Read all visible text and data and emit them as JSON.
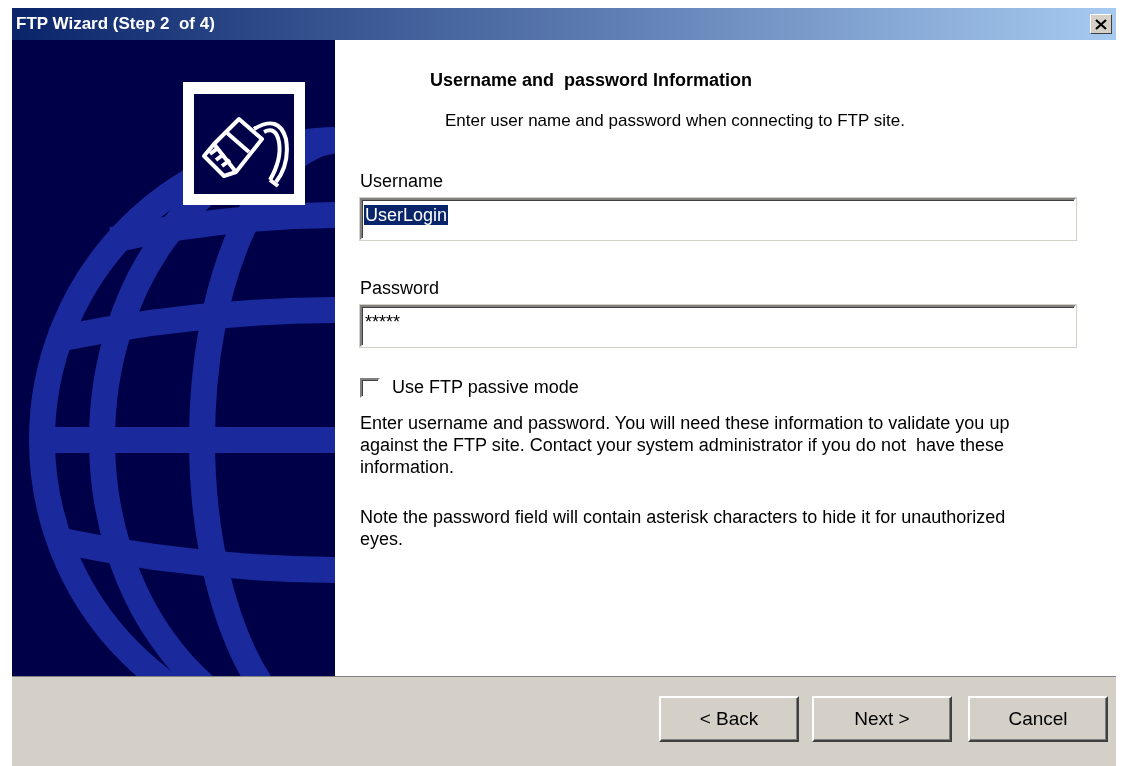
{
  "window": {
    "title": "FTP Wizard (Step 2  of 4)"
  },
  "heading": "Username and  password Information",
  "subheading": "Enter user name and password when connecting to FTP site.",
  "fields": [
    {
      "label": "Username",
      "value": "UserLogin",
      "text_selected": true
    },
    {
      "label": "Password",
      "value": "*****",
      "text_selected": false
    }
  ],
  "passive_mode": {
    "label": "Use FTP passive mode",
    "checked": false
  },
  "paragraphs": [
    "Enter username and password. You will need these information to validate you up against the FTP site. Contact your system administrator if you do not  have these information.",
    "Note the password field will contain asterisk characters to hide it for unauthorized eyes."
  ],
  "buttons": [
    {
      "label": "< Back"
    },
    {
      "label": "Next >"
    },
    {
      "label": "Cancel"
    }
  ]
}
